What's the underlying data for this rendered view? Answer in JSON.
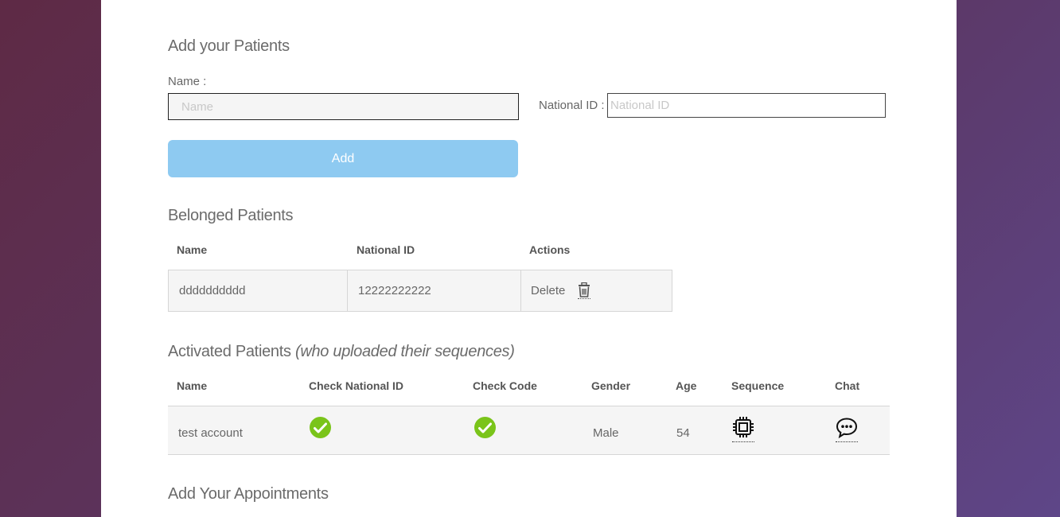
{
  "add_patients": {
    "title": "Add your Patients",
    "name_label": "Name :",
    "name_placeholder": "Name",
    "nid_label": "National ID :",
    "nid_placeholder": "National ID",
    "add_button": "Add"
  },
  "belonged": {
    "title": "Belonged Patients",
    "headers": [
      "Name",
      "National ID",
      "Actions"
    ],
    "rows": [
      {
        "name": "dddddddddd",
        "national_id": "12222222222",
        "action": "Delete",
        "action_icon": "trash-icon"
      }
    ]
  },
  "activated": {
    "title": "Activated Patients",
    "subtitle": "(who uploaded their sequences)",
    "headers": [
      "Name",
      "Check National ID",
      "Check Code",
      "Gender",
      "Age",
      "Sequence",
      "Chat"
    ],
    "rows": [
      {
        "name": "test account",
        "check_national_id_icon": "check-circle-icon",
        "check_code_icon": "check-circle-icon",
        "gender": "Male",
        "age": "54",
        "sequence_icon": "chip-icon",
        "chat_icon": "chat-bubble-icon"
      }
    ]
  },
  "appointments": {
    "title": "Add Your Appointments"
  },
  "colors": {
    "button_bg": "#8ecaf1",
    "check_green": "#7ac41a",
    "row_bg": "#f5f5f5",
    "bg_left": "#5e2a45",
    "bg_right": "#5e4688"
  }
}
